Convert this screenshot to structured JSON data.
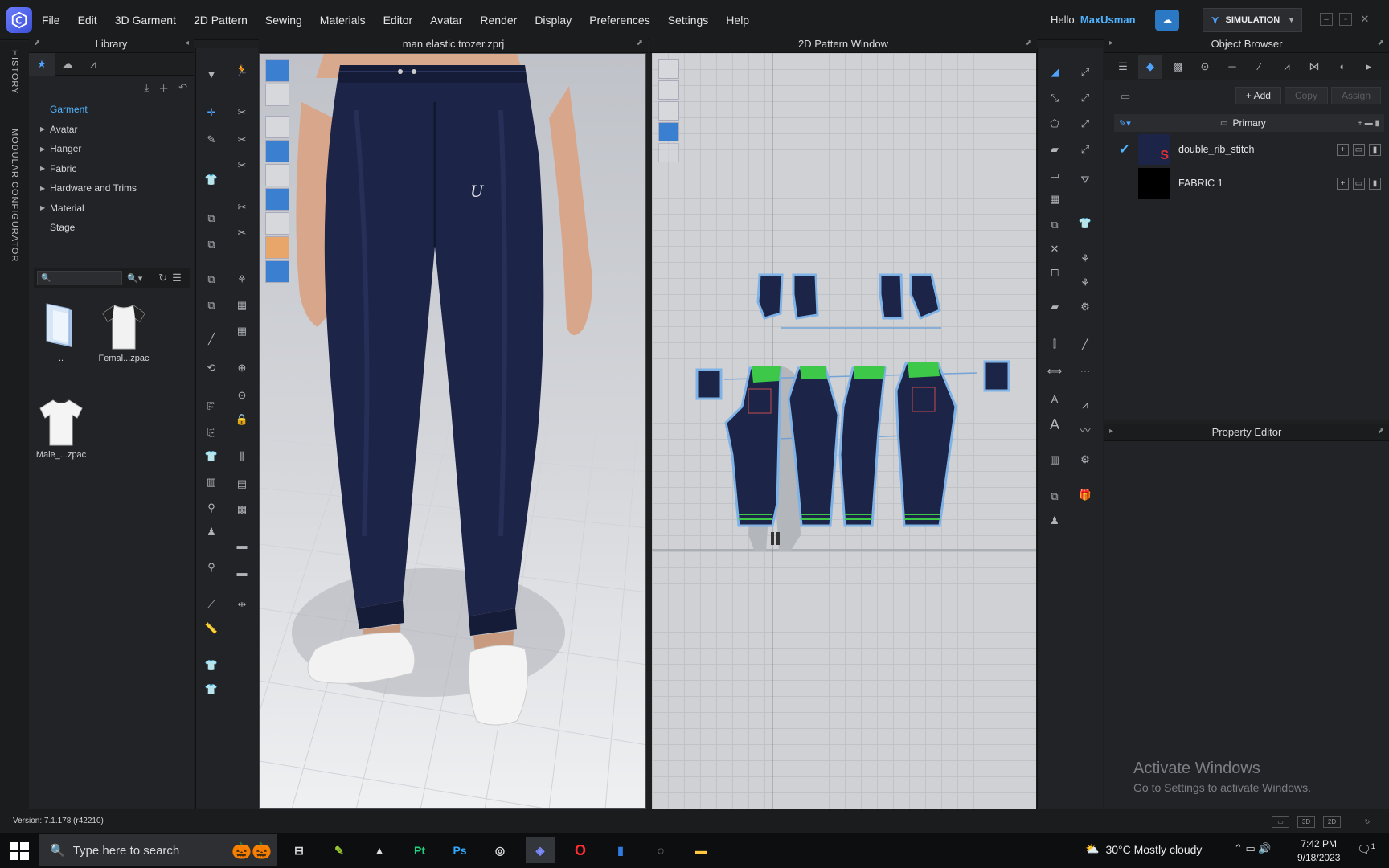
{
  "menubar": {
    "items": [
      "File",
      "Edit",
      "3D Garment",
      "2D Pattern",
      "Sewing",
      "Materials",
      "Editor",
      "Avatar",
      "Render",
      "Display",
      "Preferences",
      "Settings",
      "Help"
    ],
    "greeting": "Hello,",
    "username": "MaxUsman",
    "mode_button": "SIMULATION"
  },
  "left_tabs": {
    "history": "HISTORY",
    "modular": "MODULAR CONFIGURATOR"
  },
  "library": {
    "title": "Library",
    "tree": [
      {
        "label": "Garment",
        "expandable": false,
        "selected": true
      },
      {
        "label": "Avatar",
        "expandable": true
      },
      {
        "label": "Hanger",
        "expandable": true
      },
      {
        "label": "Fabric",
        "expandable": true
      },
      {
        "label": "Hardware and Trims",
        "expandable": true
      },
      {
        "label": "Material",
        "expandable": true
      },
      {
        "label": "Stage",
        "expandable": false
      }
    ],
    "files": [
      {
        "label": "..",
        "icon": "folder-icon"
      },
      {
        "label": "Femal...zpac",
        "icon": "female-tshirt-icon"
      },
      {
        "label": "Male_...zpac",
        "icon": "male-tshirt-icon"
      }
    ]
  },
  "view3d": {
    "title": "man elastic trozer.zprj"
  },
  "view2d": {
    "title": "2D Pattern Window"
  },
  "object_browser": {
    "title": "Object Browser",
    "buttons": {
      "add": "+ Add",
      "copy": "Copy",
      "assign": "Assign"
    },
    "group": "Primary",
    "fabrics": [
      {
        "name": "double_rib_stitch",
        "checked": true,
        "swatch": "#1c2447"
      },
      {
        "name": "FABRIC 1",
        "checked": false,
        "swatch": "#000000"
      }
    ]
  },
  "property_editor": {
    "title": "Property Editor"
  },
  "watermark": {
    "line1": "Activate Windows",
    "line2": "Go to Settings to activate Windows."
  },
  "status": {
    "version": "Version: 7.1.178 (r42210)",
    "view_buttons": [
      "3D",
      "2D"
    ]
  },
  "taskbar": {
    "search_placeholder": "Type here to search",
    "weather": "30°C  Mostly cloudy",
    "time": "7:42 PM",
    "date": "9/18/2023",
    "notif_count": "1"
  },
  "colors": {
    "accent": "#4fb3ff",
    "garment": "#1c2447",
    "panel": "#222326",
    "rib_green": "#3ec84a"
  }
}
